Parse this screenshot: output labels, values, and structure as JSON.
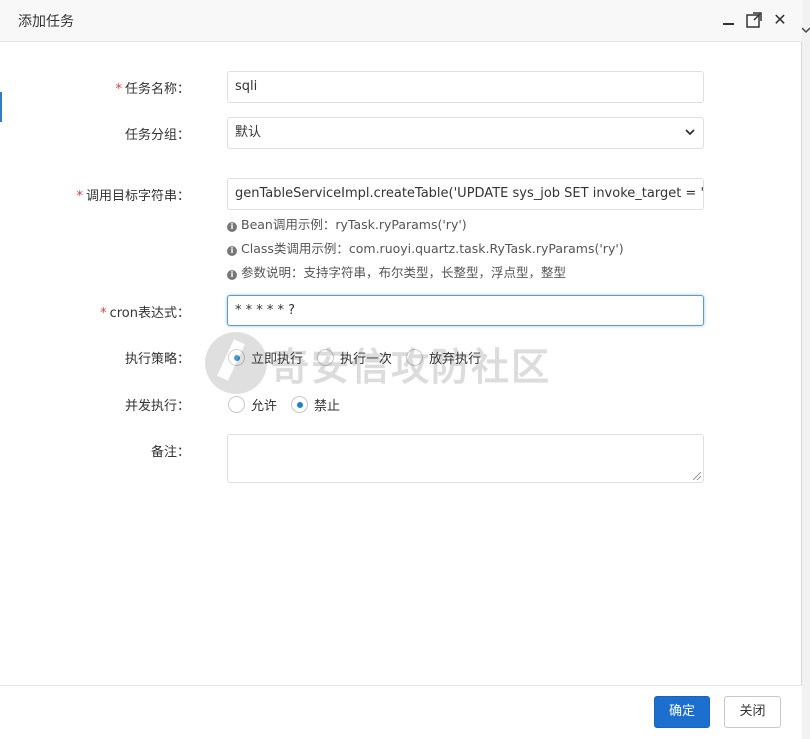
{
  "window": {
    "title": "添加任务",
    "controls": [
      "minimize-icon",
      "maximize-icon",
      "close-icon"
    ],
    "close_glyph": "✕"
  },
  "form": {
    "job_name": {
      "label": "任务名称：",
      "required": "*",
      "value": "sqli"
    },
    "job_group": {
      "label": "任务分组：",
      "value": "默认"
    },
    "invoke_target": {
      "label": "调用目标字符串：",
      "required": "*",
      "value": "genTableServiceImpl.createTable('UPDATE sys_job SET invoke_target = 'H",
      "help": [
        "Bean调用示例：ryTask.ryParams('ry')",
        "Class类调用示例：com.ruoyi.quartz.task.RyTask.ryParams('ry')",
        "参数说明：支持字符串，布尔类型，长整型，浮点型，整型"
      ]
    },
    "cron": {
      "label": "cron表达式：",
      "required": "*",
      "value": "* * * * * ?"
    },
    "misfire": {
      "label": "执行策略：",
      "options": [
        "立即执行",
        "执行一次",
        "放弃执行"
      ],
      "selected": "立即执行"
    },
    "concurrent": {
      "label": "并发执行：",
      "options": [
        "允许",
        "禁止"
      ],
      "selected": "禁止"
    },
    "remark": {
      "label": "备注：",
      "value": ""
    }
  },
  "watermark": {
    "text": "奇安信攻防社区"
  },
  "footer": {
    "confirm_label": "确定",
    "close_label": "关闭"
  },
  "colors": {
    "accent": "#1c6fcf",
    "required": "#e4393c",
    "radio_dot": "#1c84c6"
  }
}
